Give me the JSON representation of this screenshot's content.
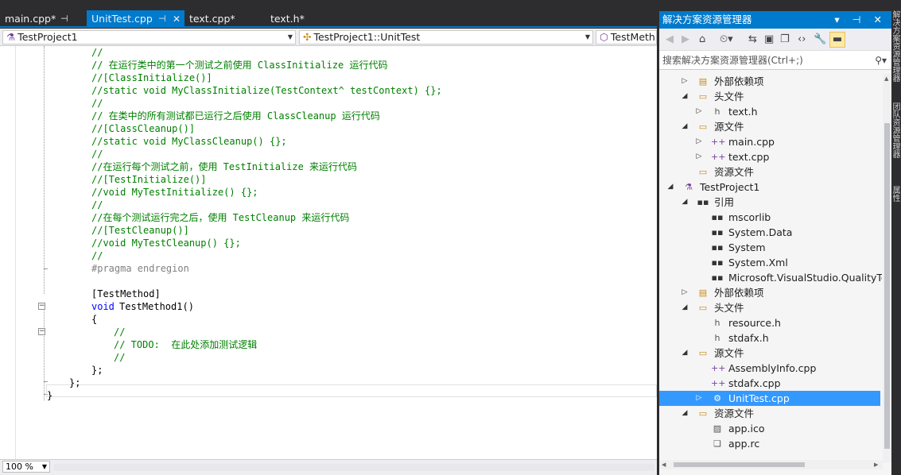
{
  "tabs": [
    {
      "label": "main.cpp*",
      "pin": "⊣"
    },
    {
      "label": "UnitTest.cpp",
      "pin": "⊣",
      "close": "✕"
    },
    {
      "label": "text.cpp*"
    },
    {
      "label": "text.h*"
    }
  ],
  "navbar": {
    "project": "TestProject1",
    "scope": "TestProject1::UnitTest",
    "member": "TestMeth"
  },
  "code_lines": [
    {
      "text": "//"
    },
    {
      "text": "// 在运行类中的第一个测试之前使用 ClassInitialize 运行代码"
    },
    {
      "text": "//[ClassInitialize()]"
    },
    {
      "text": "//static void MyClassInitialize(TestContext^ testContext) {};"
    },
    {
      "text": "//"
    },
    {
      "text": "// 在类中的所有测试都已运行之后使用 ClassCleanup 运行代码"
    },
    {
      "text": "//[ClassCleanup()]"
    },
    {
      "text": "//static void MyClassCleanup() {};"
    },
    {
      "text": "//"
    },
    {
      "text": "//在运行每个测试之前，使用 TestInitialize 来运行代码"
    },
    {
      "text": "//[TestInitialize()]"
    },
    {
      "text": "//void MyTestInitialize() {};"
    },
    {
      "text": "//"
    },
    {
      "text": "//在每个测试运行完之后，使用 TestCleanup 来运行代码"
    },
    {
      "text": "//[TestCleanup()]"
    },
    {
      "text": "//void MyTestCleanup() {};"
    },
    {
      "text": "//"
    },
    {
      "text": "#pragma endregion"
    },
    {
      "text": ""
    },
    {
      "text": "[TestMethod]"
    },
    {
      "text": "void"
    },
    {
      "text": "TestMethod1()"
    },
    {
      "text": "{"
    },
    {
      "text": "//"
    },
    {
      "text": "// TODO:  在此处添加测试逻辑"
    },
    {
      "text": "//"
    },
    {
      "text": "};"
    },
    {
      "text": "};"
    },
    {
      "text": "}"
    }
  ],
  "status": {
    "zoom": "100 %"
  },
  "solution_explorer": {
    "title": "解决方案资源管理器",
    "title_buttons": "▾ ⊣ ✕",
    "search_placeholder": "搜索解决方案资源管理器(Ctrl+;)",
    "nodes": [
      {
        "label": "外部依赖项",
        "icon": "external-deps-icon"
      },
      {
        "label": "头文件",
        "icon": "folder-icon"
      },
      {
        "label": "text.h",
        "icon": "header-file-icon"
      },
      {
        "label": "源文件",
        "icon": "folder-icon"
      },
      {
        "label": "main.cpp",
        "icon": "cpp-file-icon"
      },
      {
        "label": "text.cpp",
        "icon": "cpp-file-icon"
      },
      {
        "label": "资源文件",
        "icon": "folder-icon"
      },
      {
        "label": "TestProject1",
        "icon": "test-project-icon"
      },
      {
        "label": "引用",
        "icon": "references-icon"
      },
      {
        "label": "mscorlib",
        "icon": "assembly-icon"
      },
      {
        "label": "System.Data",
        "icon": "assembly-icon"
      },
      {
        "label": "System",
        "icon": "assembly-icon"
      },
      {
        "label": "System.Xml",
        "icon": "assembly-icon"
      },
      {
        "label": "Microsoft.VisualStudio.QualityToo",
        "icon": "assembly-icon"
      },
      {
        "label": "外部依赖项",
        "icon": "external-deps-icon"
      },
      {
        "label": "头文件",
        "icon": "folder-icon"
      },
      {
        "label": "resource.h",
        "icon": "header-file-icon"
      },
      {
        "label": "stdafx.h",
        "icon": "header-file-icon"
      },
      {
        "label": "源文件",
        "icon": "folder-icon"
      },
      {
        "label": "AssemblyInfo.cpp",
        "icon": "cpp-file-icon"
      },
      {
        "label": "stdafx.cpp",
        "icon": "cpp-file-icon"
      },
      {
        "label": "UnitTest.cpp",
        "icon": "test-cpp-file-icon"
      },
      {
        "label": "资源文件",
        "icon": "folder-icon"
      },
      {
        "label": "app.ico",
        "icon": "image-file-icon"
      },
      {
        "label": "app.rc",
        "icon": "rc-file-icon"
      }
    ]
  },
  "side_tabs": [
    "解决方案资源管理器",
    "团队资源管理器",
    "属性"
  ],
  "colors": {
    "accent": "#007acc",
    "selection": "#3399ff",
    "comment": "#008000",
    "keyword": "#0000ff"
  }
}
